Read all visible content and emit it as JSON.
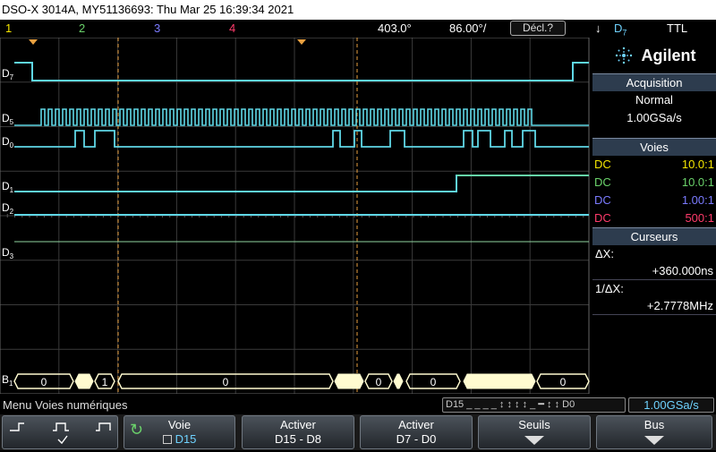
{
  "title": "DSO-X 3014A, MY51136693: Thu Mar 25 16:39:34 2021",
  "topbar": {
    "ch1": "1",
    "ch2": "2",
    "ch3": "3",
    "ch4": "4",
    "timebase": "403.0°",
    "delay": "86.00°/",
    "decl": "Décl.?",
    "trig_sym": "↓",
    "trig_src": "D",
    "trig_src_sub": "7",
    "trig_type": "TTL"
  },
  "brand": "Agilent",
  "acquisition": {
    "header": "Acquisition",
    "mode": "Normal",
    "rate": "1.00GSa/s"
  },
  "voies": {
    "header": "Voies",
    "rows": [
      {
        "coupling": "DC",
        "ratio": "10.0:1",
        "color": "#f5e600"
      },
      {
        "coupling": "DC",
        "ratio": "10.0:1",
        "color": "#6bd36b"
      },
      {
        "coupling": "DC",
        "ratio": "1.00:1",
        "color": "#7b7bff"
      },
      {
        "coupling": "DC",
        "ratio": "500:1",
        "color": "#ff3b6b"
      }
    ]
  },
  "cursors": {
    "header": "Curseurs",
    "dx_label": "ΔX:",
    "dx_value": "+360.000ns",
    "inv_label": "1/ΔX:",
    "inv_value": "+2.7778MHz"
  },
  "channel_labels": [
    {
      "name": "D",
      "sub": "7"
    },
    {
      "name": "D",
      "sub": "5"
    },
    {
      "name": "D",
      "sub": "0"
    },
    {
      "name": "D",
      "sub": "1"
    },
    {
      "name": "D",
      "sub": "2"
    },
    {
      "name": "D",
      "sub": "3"
    },
    {
      "name": "B",
      "sub": "1"
    }
  ],
  "bus_values": [
    "0",
    "1",
    "0",
    "0",
    "0",
    "0"
  ],
  "menu_label": "Menu Voies numériques",
  "status": {
    "digital_range": "D15 _ _ _ _  ↕ ↕ ↕ ↕  _ ━ ↕ ↕ D0",
    "rate": "1.00GSa/s"
  },
  "softkeys": {
    "voie_label": "Voie",
    "voie_value": "D15",
    "act1_label": "Activer",
    "act1_value": "D15 - D8",
    "act2_label": "Activer",
    "act2_value": "D7 - D0",
    "seuils_label": "Seuils",
    "bus_label": "Bus"
  },
  "colors": {
    "trace": "#5fd7e6",
    "bus": "#fffbd0",
    "grid": "#3a3a3a",
    "cursor": "#e8a040"
  }
}
